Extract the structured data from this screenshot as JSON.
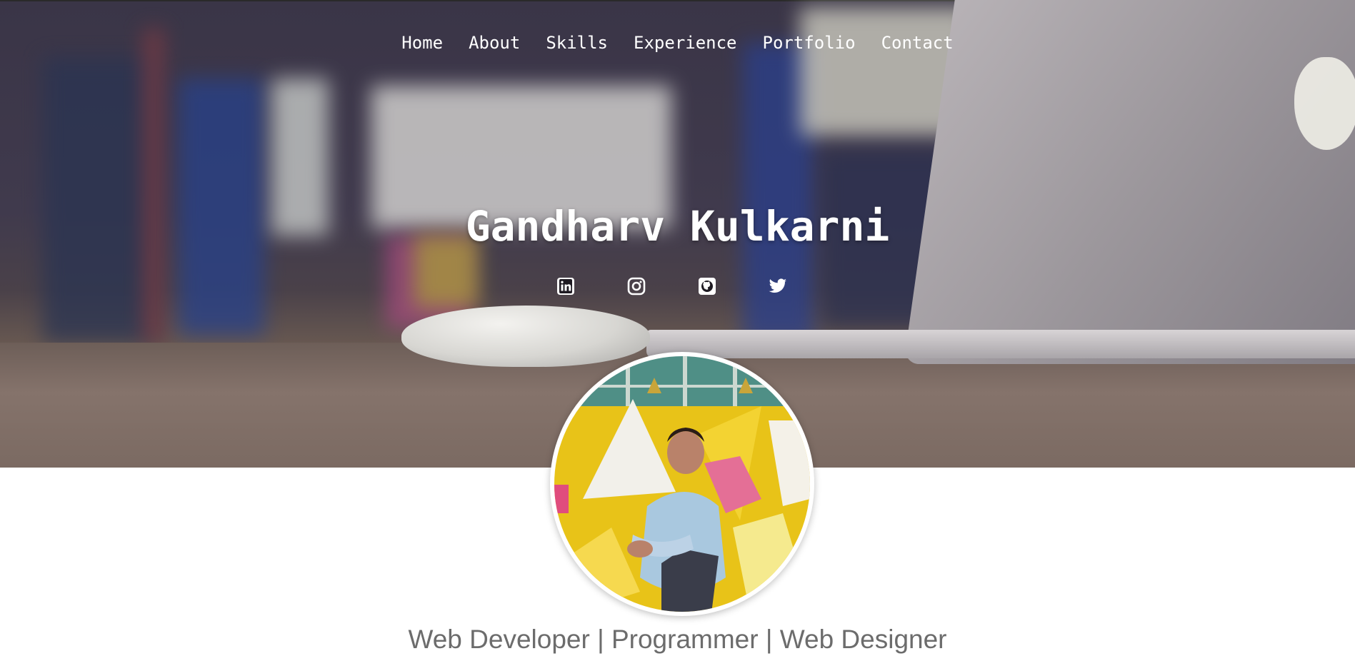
{
  "nav": {
    "items": [
      "Home",
      "About",
      "Skills",
      "Experience",
      "Portfolio",
      "Contact"
    ]
  },
  "hero": {
    "name": "Gandharv Kulkarni"
  },
  "socials": [
    {
      "icon": "linkedin-icon"
    },
    {
      "icon": "instagram-icon"
    },
    {
      "icon": "github-icon"
    },
    {
      "icon": "twitter-icon"
    }
  ],
  "profile": {
    "tagline": "Web Developer | Programmer | Web Designer"
  },
  "colors": {
    "nav_text": "#ffffff",
    "tagline": "#6c6c6c"
  }
}
